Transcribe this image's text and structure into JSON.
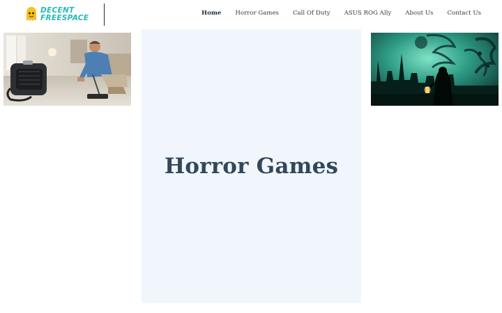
{
  "header": {
    "logo": {
      "line1": "DECENT",
      "line2": "FREESPACE"
    },
    "nav": [
      {
        "label": "Home",
        "active": true
      },
      {
        "label": "Horror Games",
        "active": false
      },
      {
        "label": "Call Of Duty",
        "active": false
      },
      {
        "label": "ASUS ROG Ally",
        "active": false
      },
      {
        "label": "About Us",
        "active": false
      },
      {
        "label": "Contact Us",
        "active": false
      }
    ]
  },
  "hero": {
    "title": "Horror Games"
  },
  "colors": {
    "logo_teal": "#28b9b2",
    "logo_yellow": "#f6c21a",
    "hero_bg": "#f1f6fd",
    "hero_text": "#33475b",
    "nav_text": "#3a3a3a"
  },
  "images": {
    "left": "man-with-vacuum-image",
    "right": "horror-monster-city-image"
  }
}
